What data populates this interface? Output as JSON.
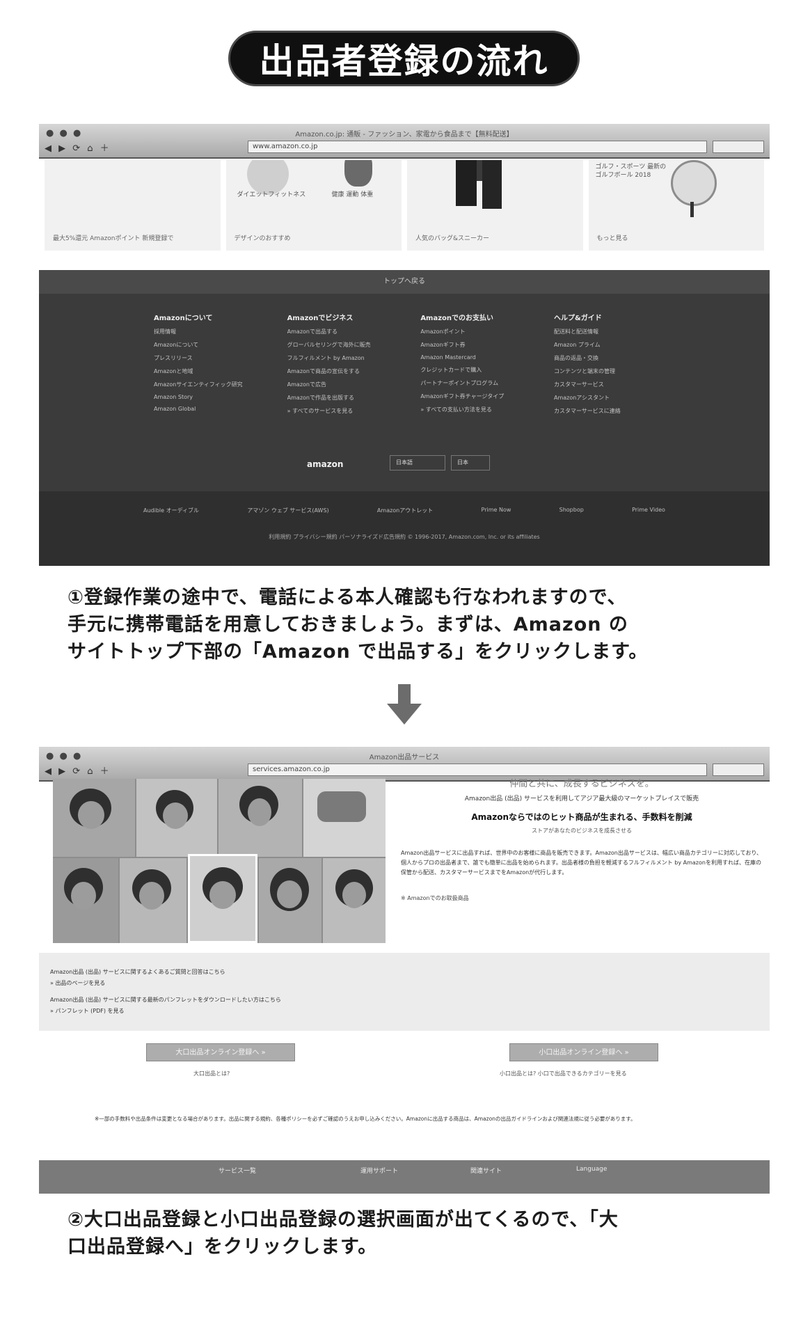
{
  "title": "出品者登録の流れ",
  "step1": {
    "browser": {
      "window_title": "Amazon.co.jp: 通販 - ファッション、家電から食品まで【無料配送】",
      "url": "www.amazon.co.jp"
    },
    "tiles": {
      "captions": [
        "最大5%還元 Amazonポイント 新規登録で",
        "デザインのおすすめ",
        "人気のバッグ&スニーカー",
        "もっと見る"
      ],
      "tile2_text": "ダイエットフィットネス",
      "tile2_tags": "健康 運動 体重",
      "tile4_text": "ゴルフ・スポーツ 最新のゴルフボール 2018"
    },
    "footer": {
      "back_to_top": "トップへ戻る",
      "columns": [
        {
          "heading": "Amazonについて",
          "items": [
            "採用情報",
            "Amazonについて",
            "プレスリリース",
            "Amazonと地域",
            "Amazonサイエンティフィック研究",
            "Amazon Story",
            "Amazon Global"
          ]
        },
        {
          "heading": "Amazonでビジネス",
          "items": [
            "Amazonで出品する",
            "グローバルセリングで海外に販売",
            "フルフィルメント by Amazon",
            "Amazonで商品の宣伝をする",
            "Amazonで広告",
            "Amazonで作品を出版する",
            "» すべてのサービスを見る"
          ]
        },
        {
          "heading": "Amazonでのお支払い",
          "items": [
            "Amazonポイント",
            "Amazonギフト券",
            "Amazon Mastercard",
            "クレジットカードで購入",
            "パートナーポイントプログラム",
            "Amazonギフト券チャージタイプ",
            "» すべての支払い方法を見る"
          ]
        },
        {
          "heading": "ヘルプ&ガイド",
          "items": [
            "配送料と配送情報",
            "Amazon プライム",
            "商品の返品・交換",
            "コンテンツと端末の管理",
            "カスタマーサービス",
            "Amazonアシスタント",
            "カスタマーサービスに連絡"
          ]
        }
      ],
      "logo": "amazon",
      "language": "日本語",
      "region": "日本",
      "bottom_links": [
        "Audible オーディブル",
        "アマゾン ウェブ サービス(AWS)",
        "Amazonアウトレット",
        "Prime Now",
        "Shopbop",
        "Prime Video"
      ],
      "legal": "利用規約 プライバシー規約 パーソナライズド広告規約 © 1996-2017, Amazon.com, Inc. or its affiliates"
    }
  },
  "caption1": "①登録作業の途中で、電話による本人確認も行なわれますので、\n手元に携帯電話を用意しておきましょう。まずは、Amazon の\nサイトトップ下部の「Amazon で出品する」をクリックします。",
  "step2": {
    "browser": {
      "window_title": "Amazon出品サービス",
      "url": "services.amazon.co.jp"
    },
    "headline_small": "仲間と共に、成長するビジネスを。",
    "intro": "Amazon出品 (出品) サービスを利用してアジア最大級のマーケットプレイスで販売",
    "heading": "Amazonならではのヒット商品が生まれる、手数料を削減",
    "subheading": "ストアがあなたのビジネスを成長させる",
    "body": "Amazon出品サービスに出品すれば、世界中のお客様に商品を販売できます。Amazon出品サービスは、幅広い商品カテゴリーに対応しており、個人からプロの出品者まで、誰でも簡単に出品を始められます。出品者様の負担を軽減するフルフィルメント by Amazonを利用すれば、在庫の保管から配送、カスタマーサービスまでをAmazonが代行します。",
    "note": "※ Amazonでのお取扱商品",
    "info_lines": [
      "Amazon出品 (出品) サービスに関するよくあるご質問と回答はこちら",
      "» 出品のページを見る",
      "Amazon出品 (出品) サービスに関する最新のパンフレットをダウンロードしたい方はこちら",
      "» パンフレット (PDF) を見る"
    ],
    "btn_large": "大口出品オンライン登録へ »",
    "btn_large_sub": "大口出品とは?",
    "btn_small": "小口出品オンライン登録へ »",
    "btn_small_sub": "小口出品とは? 小口で出品できるカテゴリーを見る",
    "fine_print": "※一部の手数料や出品条件は変更となる場合があります。出品に関する規約、各種ポリシーを必ずご確認のうえお申し込みください。Amazonに出品する商品は、Amazonの出品ガイドラインおよび関連法規に従う必要があります。",
    "bottom_bar": [
      "サービス一覧",
      "運用サポート",
      "関連サイト",
      "Language"
    ]
  },
  "caption2": "②大口出品登録と小口出品登録の選択画面が出てくるので、「大\n口出品登録へ」をクリックします。"
}
